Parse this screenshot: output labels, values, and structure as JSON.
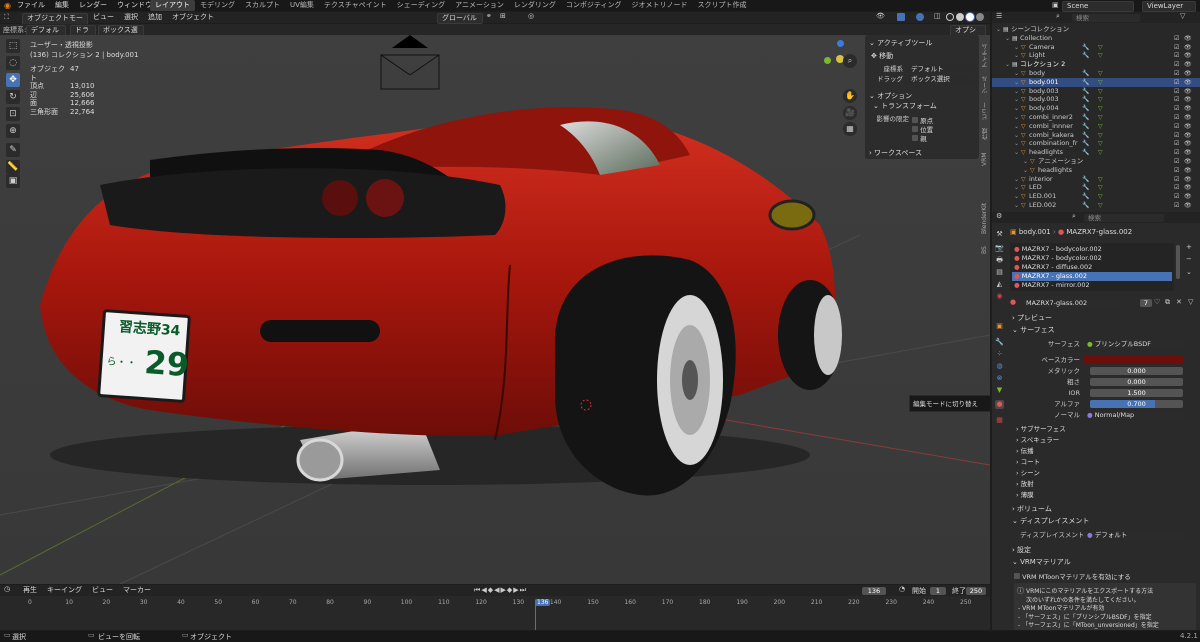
{
  "topbar": {
    "menus": [
      "ファイル",
      "編集",
      "レンダー",
      "ウィンドウ",
      "ヘルプ"
    ],
    "workspaces": [
      "レイアウト",
      "モデリング",
      "スカルプト",
      "UV編集",
      "テクスチャペイント",
      "シェーディング",
      "アニメーション",
      "レンダリング",
      "コンポジティング",
      "ジオメトリノード",
      "スクリプト作成"
    ],
    "active_workspace": "レイアウト",
    "scene": "Scene",
    "view_layer": "ViewLayer"
  },
  "viewport_header": {
    "mode": "オブジェクトモード",
    "menus": [
      "ビュー",
      "選択",
      "追加",
      "オブジェクト"
    ],
    "transform": "グローバル",
    "orient_label": "座標系:",
    "orient_value": "デフォルト",
    "drag_label": "ドラッグ:",
    "drag_value": "ボックス選択",
    "options": "オプション"
  },
  "viewport_info": {
    "view": "ユーザー・透視投影",
    "collection": "(136) コレクション 2 | body.001",
    "stats": [
      {
        "k": "オブジェクト",
        "v": "47"
      },
      {
        "k": "頂点",
        "v": "13,010"
      },
      {
        "k": "辺",
        "v": "25,606"
      },
      {
        "k": "面",
        "v": "12,666"
      },
      {
        "k": "三角形面",
        "v": "22,764"
      }
    ]
  },
  "plate": {
    "top": "習志野34",
    "bottom_left": "ら・・",
    "number": "29"
  },
  "tool_panel": {
    "active_tool": "アクティブツール",
    "move": "移動",
    "orient_label": "座標系",
    "orient_value": "デフォルト",
    "drag_label": "ドラッグ",
    "drag_value": "ボックス選択",
    "options": "オプション",
    "transform": "トランスフォーム",
    "affect_only": "影響の限定",
    "origins": "原点",
    "locations": "位置",
    "parents": "親",
    "workspace": "ワークスペース"
  },
  "sidebar_tabs": [
    "アイテム",
    "ツール",
    "ビュー",
    "作成",
    "VRM",
    "BlenderKit",
    "BS"
  ],
  "tooltip": "編集モードに切り替え",
  "outliner": {
    "search_placeholder": "検索",
    "items": [
      {
        "label": "シーンコレクション",
        "indent": 0
      },
      {
        "label": "Collection",
        "indent": 1
      },
      {
        "label": "Camera",
        "indent": 2
      },
      {
        "label": "Light",
        "indent": 2
      },
      {
        "label": "コレクション 2",
        "indent": 1
      },
      {
        "label": "body",
        "indent": 2
      },
      {
        "label": "body.001",
        "indent": 2
      },
      {
        "label": "body.003",
        "indent": 2
      },
      {
        "label": "body.003",
        "indent": 2
      },
      {
        "label": "body.004",
        "indent": 2
      },
      {
        "label": "combi_inner2",
        "indent": 2
      },
      {
        "label": "combi_innner",
        "indent": 2
      },
      {
        "label": "combi_kakera",
        "indent": 2
      },
      {
        "label": "combination_fr",
        "indent": 2
      },
      {
        "label": "headlights",
        "indent": 2
      },
      {
        "label": "アニメーション",
        "indent": 3
      },
      {
        "label": "headlights",
        "indent": 3
      },
      {
        "label": "interior",
        "indent": 2
      },
      {
        "label": "LED",
        "indent": 2
      },
      {
        "label": "LED.001",
        "indent": 2
      },
      {
        "label": "LED.002",
        "indent": 2
      }
    ]
  },
  "properties": {
    "search_placeholder": "検索",
    "breadcrumb_obj": "body.001",
    "breadcrumb_mat": "MAZRX7-glass.002",
    "slots": [
      "MAZRX7 - bodycolor.002",
      "MAZRX7 - bodycolor.002",
      "MAZRX7 - diffuse.002",
      "MAZRX7 - glass.002",
      "MAZRX7 - mirror.002"
    ],
    "selected_slot": 3,
    "material_name": "MAZRX7-glass.002",
    "users": "7",
    "preview": "プレビュー",
    "surface_panel": "サーフェス",
    "surface_label": "サーフェス",
    "surface_value": "プリンシプルBSDF",
    "base_color": "ベースカラー",
    "metallic_label": "メタリック",
    "metallic": "0.000",
    "roughness_label": "粗さ",
    "roughness": "0.000",
    "ior_label": "IOR",
    "ior": "1.500",
    "alpha_label": "アルファ",
    "alpha": "0.700",
    "alpha_fill": 0.7,
    "normal_label": "ノーマル",
    "normal_value": "Normal/Map",
    "subpanels": [
      "サブサーフェス",
      "スペキュラー",
      "伝播",
      "コート",
      "シーン",
      "放射",
      "薄膜"
    ],
    "volume": "ボリューム",
    "displacement": "ディスプレイスメント",
    "displacement_label": "ディスプレイスメント",
    "displacement_value": "デフォルト",
    "settings": "設定",
    "vrm_material": "VRMマテリアル",
    "vrm_enable": "VRM MToonマテリアルを有効にする",
    "vrm_note": [
      "VRMにこのマテリアルをエクスポートする方法",
      "次のいずれかの条件を満たしてください。",
      "- VRM MToonマテリアルが有効",
      "- 「サーフェス」に「プリンシプルBSDF」を指定",
      "- 「サーフェス」に「MToon_unversioned」を指定"
    ]
  },
  "timeline": {
    "menus": [
      "再生",
      "キーイング",
      "ビュー",
      "マーカー"
    ],
    "current": "136",
    "start_label": "開始",
    "start": "1",
    "end_label": "終了",
    "end": "250",
    "ticks": [
      "0",
      "10",
      "20",
      "30",
      "40",
      "50",
      "60",
      "70",
      "80",
      "90",
      "100",
      "110",
      "120",
      "130",
      "136",
      "140",
      "150",
      "160",
      "170",
      "180",
      "190",
      "200",
      "210",
      "220",
      "230",
      "240",
      "250"
    ]
  },
  "statusbar": {
    "left": "選択",
    "mid": "ビューを回転",
    "right": "オブジェクト",
    "version": "4.2.1"
  },
  "colors": {
    "accent": "#4772b3",
    "car_red": "#b0160c",
    "bg": "#3d3d3d"
  }
}
